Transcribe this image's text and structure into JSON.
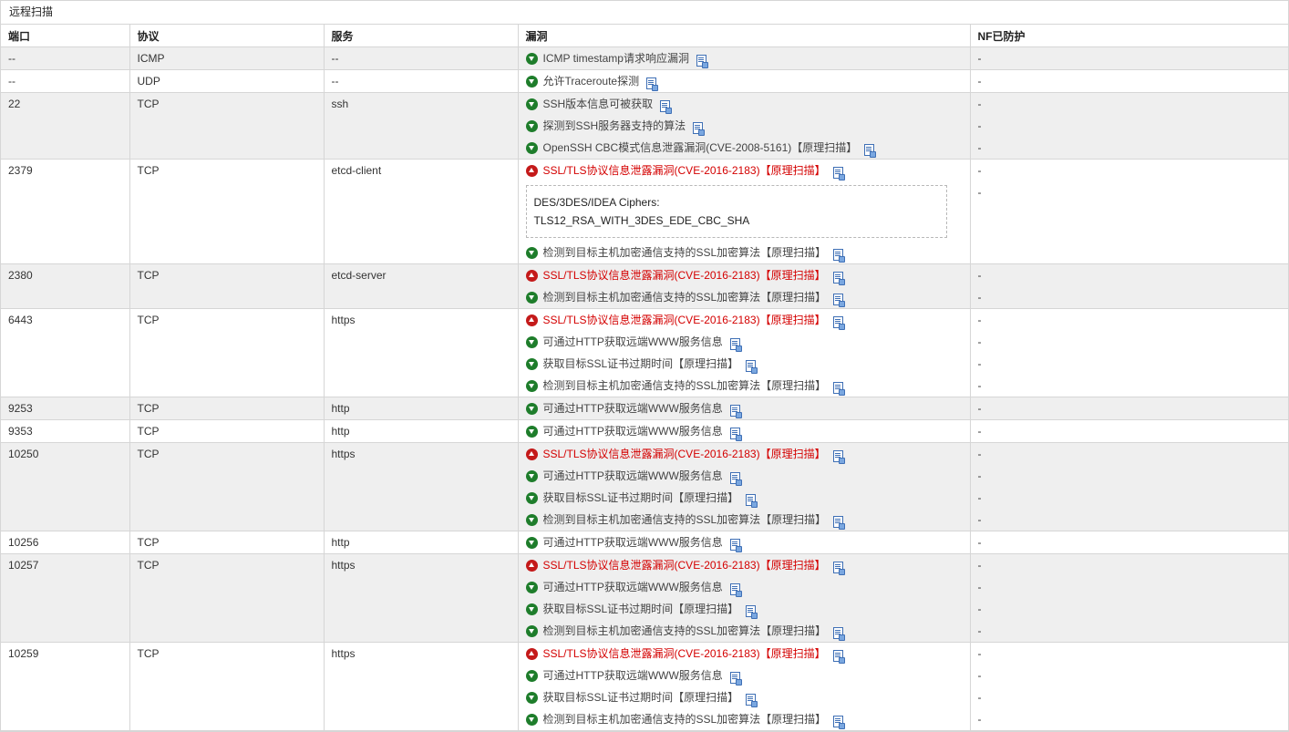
{
  "title": "远程扫描",
  "headers": {
    "port": "端口",
    "protocol": "协议",
    "service": "服务",
    "vuln": "漏洞",
    "protected": "NF已防护"
  },
  "icons": {
    "low": "green-down-arrow-icon",
    "high": "red-up-arrow-icon",
    "doc": "document-icon"
  },
  "colors": {
    "high_text": "#d40000",
    "low_icon": "#1e7d2b",
    "high_icon": "#c41a1a"
  },
  "rows": [
    {
      "port": "--",
      "protocol": "ICMP",
      "service": "--",
      "vulns": [
        {
          "level": "low",
          "text": "ICMP timestamp请求响应漏洞"
        }
      ],
      "protected": [
        "-"
      ]
    },
    {
      "port": "--",
      "protocol": "UDP",
      "service": "--",
      "vulns": [
        {
          "level": "low",
          "text": "允许Traceroute探测"
        }
      ],
      "protected": [
        "-"
      ]
    },
    {
      "port": "22",
      "protocol": "TCP",
      "service": "ssh",
      "vulns": [
        {
          "level": "low",
          "text": "SSH版本信息可被获取"
        },
        {
          "level": "low",
          "text": "探测到SSH服务器支持的算法"
        },
        {
          "level": "low",
          "text": "OpenSSH CBC模式信息泄露漏洞(CVE-2008-5161)【原理扫描】"
        }
      ],
      "protected": [
        "-",
        "-",
        "-"
      ]
    },
    {
      "port": "2379",
      "protocol": "TCP",
      "service": "etcd-client",
      "vulns": [
        {
          "level": "high",
          "text": "SSL/TLS协议信息泄露漏洞(CVE-2016-2183)【原理扫描】"
        },
        {
          "level": "low",
          "text": "检测到目标主机加密通信支持的SSL加密算法【原理扫描】"
        }
      ],
      "detail": [
        "DES/3DES/IDEA Ciphers:",
        "TLS12_RSA_WITH_3DES_EDE_CBC_SHA"
      ],
      "protected": [
        "-",
        "-"
      ]
    },
    {
      "port": "2380",
      "protocol": "TCP",
      "service": "etcd-server",
      "vulns": [
        {
          "level": "high",
          "text": "SSL/TLS协议信息泄露漏洞(CVE-2016-2183)【原理扫描】"
        },
        {
          "level": "low",
          "text": "检测到目标主机加密通信支持的SSL加密算法【原理扫描】"
        }
      ],
      "protected": [
        "-",
        "-"
      ]
    },
    {
      "port": "6443",
      "protocol": "TCP",
      "service": "https",
      "vulns": [
        {
          "level": "high",
          "text": "SSL/TLS协议信息泄露漏洞(CVE-2016-2183)【原理扫描】"
        },
        {
          "level": "low",
          "text": "可通过HTTP获取远端WWW服务信息"
        },
        {
          "level": "low",
          "text": "获取目标SSL证书过期时间【原理扫描】"
        },
        {
          "level": "low",
          "text": "检测到目标主机加密通信支持的SSL加密算法【原理扫描】"
        }
      ],
      "protected": [
        "-",
        "-",
        "-",
        "-"
      ]
    },
    {
      "port": "9253",
      "protocol": "TCP",
      "service": "http",
      "vulns": [
        {
          "level": "low",
          "text": "可通过HTTP获取远端WWW服务信息"
        }
      ],
      "protected": [
        "-"
      ]
    },
    {
      "port": "9353",
      "protocol": "TCP",
      "service": "http",
      "vulns": [
        {
          "level": "low",
          "text": "可通过HTTP获取远端WWW服务信息"
        }
      ],
      "protected": [
        "-"
      ]
    },
    {
      "port": "10250",
      "protocol": "TCP",
      "service": "https",
      "vulns": [
        {
          "level": "high",
          "text": "SSL/TLS协议信息泄露漏洞(CVE-2016-2183)【原理扫描】"
        },
        {
          "level": "low",
          "text": "可通过HTTP获取远端WWW服务信息"
        },
        {
          "level": "low",
          "text": "获取目标SSL证书过期时间【原理扫描】"
        },
        {
          "level": "low",
          "text": "检测到目标主机加密通信支持的SSL加密算法【原理扫描】"
        }
      ],
      "protected": [
        "-",
        "-",
        "-",
        "-"
      ]
    },
    {
      "port": "10256",
      "protocol": "TCP",
      "service": "http",
      "vulns": [
        {
          "level": "low",
          "text": "可通过HTTP获取远端WWW服务信息"
        }
      ],
      "protected": [
        "-"
      ]
    },
    {
      "port": "10257",
      "protocol": "TCP",
      "service": "https",
      "vulns": [
        {
          "level": "high",
          "text": "SSL/TLS协议信息泄露漏洞(CVE-2016-2183)【原理扫描】"
        },
        {
          "level": "low",
          "text": "可通过HTTP获取远端WWW服务信息"
        },
        {
          "level": "low",
          "text": "获取目标SSL证书过期时间【原理扫描】"
        },
        {
          "level": "low",
          "text": "检测到目标主机加密通信支持的SSL加密算法【原理扫描】"
        }
      ],
      "protected": [
        "-",
        "-",
        "-",
        "-"
      ]
    },
    {
      "port": "10259",
      "protocol": "TCP",
      "service": "https",
      "vulns": [
        {
          "level": "high",
          "text": "SSL/TLS协议信息泄露漏洞(CVE-2016-2183)【原理扫描】"
        },
        {
          "level": "low",
          "text": "可通过HTTP获取远端WWW服务信息"
        },
        {
          "level": "low",
          "text": "获取目标SSL证书过期时间【原理扫描】"
        },
        {
          "level": "low",
          "text": "检测到目标主机加密通信支持的SSL加密算法【原理扫描】"
        }
      ],
      "protected": [
        "-",
        "-",
        "-",
        "-"
      ]
    }
  ]
}
